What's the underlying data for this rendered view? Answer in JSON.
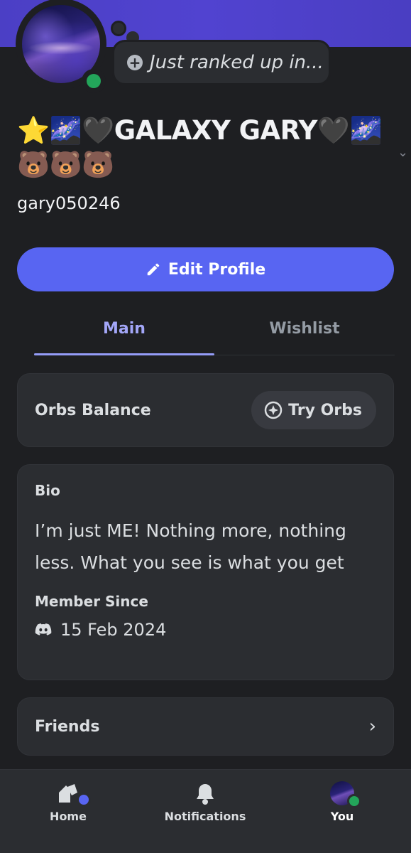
{
  "profile": {
    "display_name": "⭐🌌🖤GALAXY GARY🖤🌌🐻🐻🐻",
    "username": "gary050246",
    "status_text": "Just ranked up in...",
    "online_status_color": "#23a55a"
  },
  "actions": {
    "edit_profile_label": "Edit Profile"
  },
  "tabs": [
    {
      "label": "Main",
      "active": true
    },
    {
      "label": "Wishlist",
      "active": false
    }
  ],
  "orbs": {
    "label": "Orbs Balance",
    "button_label": "Try Orbs"
  },
  "bio": {
    "heading": "Bio",
    "text": "I’m just ME! Nothing more, nothing less. What you see is what you get",
    "member_since_heading": "Member Since",
    "member_since_date": "15 Feb 2024"
  },
  "friends": {
    "label": "Friends"
  },
  "nav": {
    "home": "Home",
    "notifications": "Notifications",
    "you": "You"
  },
  "colors": {
    "accent": "#5865f2",
    "banner": "#4b3fc5",
    "background": "#1e1f22",
    "card": "#2b2d31"
  }
}
